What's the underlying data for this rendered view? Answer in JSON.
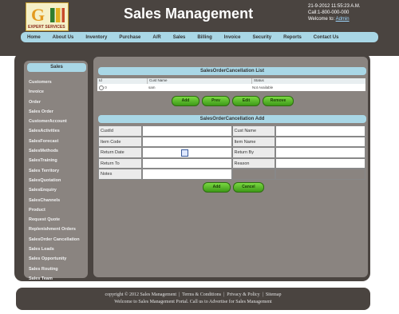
{
  "header": {
    "logo_text": "EXPERT SERVICES",
    "title": "Sales Management",
    "datetime": "21-9-2012 11:55:23 A.M.",
    "call": "Call:1-800-000-000",
    "welcome_prefix": "Welcome to:",
    "welcome_link": "Admin"
  },
  "nav": [
    "Home",
    "About Us",
    "Inventory",
    "Purchase",
    "A/R",
    "Sales",
    "Billing",
    "Invoice",
    "Security",
    "Reports",
    "Contact Us"
  ],
  "sidebar": {
    "title": "Sales",
    "items": [
      "Customers",
      "Invoice",
      "Order",
      "Sales Order",
      "CustomerAccount",
      "SalesActivities",
      "SalesForecast",
      "SalesMethods",
      "SalesTraining",
      "Sales Territory",
      "SalesQuotation",
      "SalesEnquiry",
      "SalesChannels",
      "Product",
      "Request Quote",
      "Replenishment Orders",
      "SalesOrder Cancellation",
      "Sales Leads",
      "Sales Opportunity",
      "Sales Routing",
      "Sales Team"
    ]
  },
  "list_panel": {
    "title": "SalesOrderCancellation List",
    "columns": [
      "Id",
      "Cust Name",
      "Status"
    ],
    "row": {
      "id": "0",
      "cust": "sam",
      "status": "Not Available"
    },
    "buttons": [
      "Add",
      "Prev",
      "Edit",
      "Remove"
    ]
  },
  "form_panel": {
    "title": "SalesOrderCancellation Add",
    "fields": [
      [
        "CustId",
        "Cust Name"
      ],
      [
        "Item Code",
        "Item Name"
      ],
      [
        "Return Date",
        "Return By"
      ],
      [
        "Return To",
        "Reason"
      ],
      [
        "Notes",
        ""
      ]
    ],
    "buttons": [
      "Add",
      "Cancel"
    ]
  },
  "footer": {
    "copyright": "copyright © 2012 Sales Management",
    "links": [
      "Terms & Conditions",
      "Privacy & Policy",
      "Sitemap"
    ],
    "tagline": "Welcome to Sales Management Portal. Call us to Advertise for Sales Management"
  },
  "colors": {
    "frame": "#4a4440",
    "panel": "#8a8480",
    "accent": "#a9d7e6",
    "button": "#5cbf2a"
  }
}
